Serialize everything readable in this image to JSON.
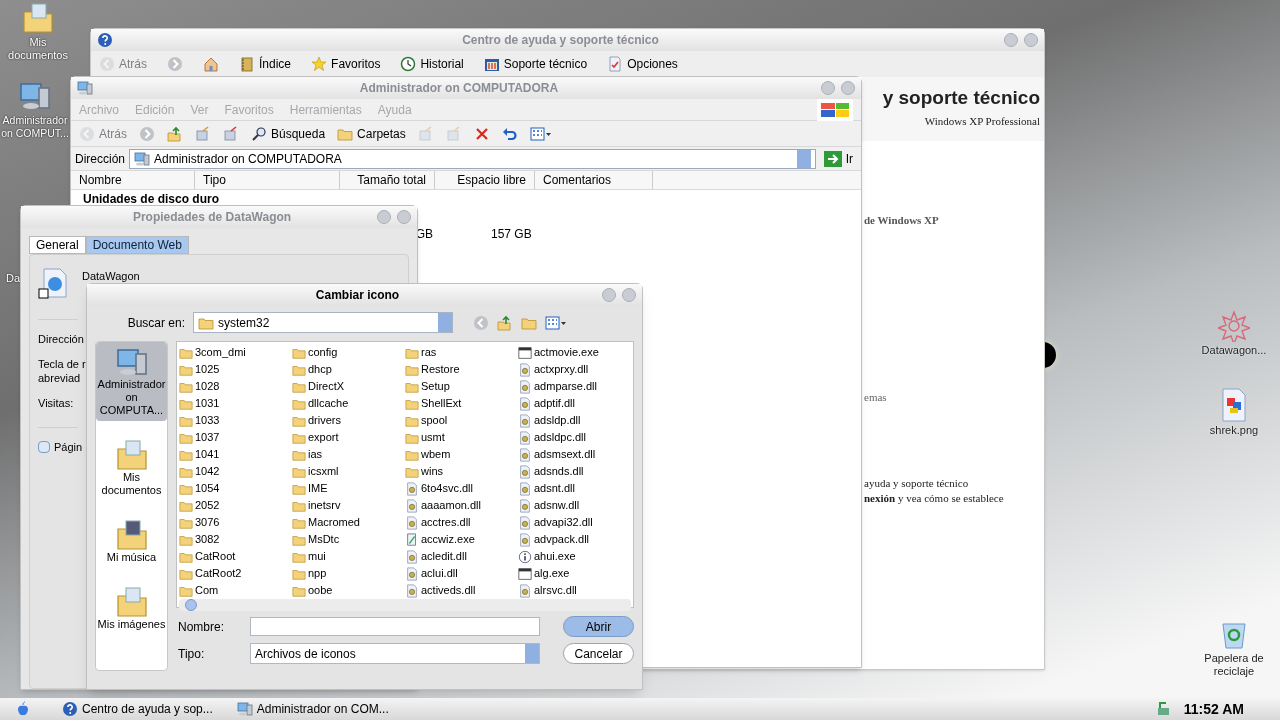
{
  "desktop_icons": [
    {
      "label": "Mis documentos",
      "kind": "documents"
    },
    {
      "label": "Administrador on COMPUT...",
      "kind": "computer"
    },
    {
      "label": "Da",
      "kind": "hidden"
    },
    {
      "label": "Datawagon...",
      "kind": "flower"
    },
    {
      "label": "shrek.png",
      "kind": "image"
    },
    {
      "label": "Papelera de reciclaje",
      "kind": "recycle"
    }
  ],
  "help_window": {
    "title": "Centro de ayuda y soporte técnico",
    "toolbar": [
      {
        "label": "Atrás",
        "kind": "back",
        "disabled": true
      },
      {
        "kind": "forward",
        "disabled": false
      },
      {
        "kind": "home",
        "disabled": false
      },
      {
        "label": "Índice",
        "kind": "index",
        "disabled": false
      },
      {
        "label": "Favoritos",
        "kind": "star",
        "disabled": false
      },
      {
        "label": "Historial",
        "kind": "history",
        "disabled": false
      },
      {
        "label": "Soporte técnico",
        "kind": "support",
        "disabled": false
      },
      {
        "label": "Opciones",
        "kind": "options",
        "disabled": false
      }
    ],
    "heading": "y soporte técnico",
    "subtitle": "Windows XP Professional",
    "fragments": [
      {
        "text": "de Windows XP",
        "kind": "bold"
      },
      {
        "text": "emas",
        "kind": "plain"
      },
      {
        "text": "ayuda y soporte técnico",
        "kind": "plain"
      },
      {
        "text": "**nexión** y vea cómo se establece",
        "kind": "plain"
      }
    ]
  },
  "explorer": {
    "title": "Administrador on COMPUTADORA",
    "menu": [
      "Archivo",
      "Edición",
      "Ver",
      "Favoritos",
      "Herramientas",
      "Ayuda"
    ],
    "toolbar": [
      {
        "label": "Atrás",
        "kind": "back",
        "disabled": true
      },
      {
        "kind": "forward",
        "disabled": false
      },
      {
        "kind": "up",
        "disabled": false
      },
      {
        "kind": "copy-to",
        "disabled": false
      },
      {
        "kind": "move-to",
        "disabled": false
      },
      {
        "label": "Búsqueda",
        "kind": "search",
        "disabled": false
      },
      {
        "label": "Carpetas",
        "kind": "folders",
        "disabled": false
      },
      {
        "kind": "move",
        "disabled": true
      },
      {
        "kind": "copy",
        "disabled": true
      },
      {
        "kind": "delete",
        "disabled": false
      },
      {
        "kind": "undo",
        "disabled": false
      },
      {
        "kind": "views",
        "disabled": false
      }
    ],
    "address_label": "Dirección",
    "address": "Administrador on COMPUTADORA",
    "go_label": "Ir",
    "columns": [
      "Nombre",
      "Tipo",
      "Tamaño total",
      "Espacio libre",
      "Comentarios"
    ],
    "group": "Unidades de disco duro",
    "row": {
      "total": "GB",
      "free": "157 GB"
    }
  },
  "properties": {
    "title": "Propiedades de DataWagon",
    "tabs": [
      {
        "label": "General",
        "selected": false
      },
      {
        "label": "Documento Web",
        "selected": true
      }
    ],
    "name": "DataWagon",
    "labels": [
      "Dirección",
      "Tecla de r",
      "abreviad",
      "Visitas:"
    ],
    "checkbox": {
      "label": "Págin",
      "checked": false
    }
  },
  "change_icon": {
    "title": "Cambiar icono",
    "look_in_label": "Buscar en:",
    "look_in": "system32",
    "places": [
      {
        "label": "Administrador on COMPUTA...",
        "kind": "computer",
        "selected": true
      },
      {
        "label": "Mis documentos",
        "kind": "documents",
        "selected": false
      },
      {
        "label": "Mi música",
        "kind": "music",
        "selected": false
      },
      {
        "label": "Mis imágenes",
        "kind": "pictures",
        "selected": false
      }
    ],
    "files": [
      {
        "name": "3com_dmi",
        "kind": "folder"
      },
      {
        "name": "1025",
        "kind": "folder"
      },
      {
        "name": "1028",
        "kind": "folder"
      },
      {
        "name": "1031",
        "kind": "folder"
      },
      {
        "name": "1033",
        "kind": "folder"
      },
      {
        "name": "1037",
        "kind": "folder"
      },
      {
        "name": "1041",
        "kind": "folder"
      },
      {
        "name": "1042",
        "kind": "folder"
      },
      {
        "name": "1054",
        "kind": "folder"
      },
      {
        "name": "2052",
        "kind": "folder"
      },
      {
        "name": "3076",
        "kind": "folder"
      },
      {
        "name": "3082",
        "kind": "folder"
      },
      {
        "name": "CatRoot",
        "kind": "folder"
      },
      {
        "name": "CatRoot2",
        "kind": "folder"
      },
      {
        "name": "Com",
        "kind": "folder"
      },
      {
        "name": "config",
        "kind": "folder"
      },
      {
        "name": "dhcp",
        "kind": "folder"
      },
      {
        "name": "DirectX",
        "kind": "folder"
      },
      {
        "name": "dllcache",
        "kind": "folder"
      },
      {
        "name": "drivers",
        "kind": "folder"
      },
      {
        "name": "export",
        "kind": "folder"
      },
      {
        "name": "ias",
        "kind": "folder"
      },
      {
        "name": "icsxml",
        "kind": "folder"
      },
      {
        "name": "IME",
        "kind": "folder"
      },
      {
        "name": "inetsrv",
        "kind": "folder"
      },
      {
        "name": "Macromed",
        "kind": "folder"
      },
      {
        "name": "MsDtc",
        "kind": "folder"
      },
      {
        "name": "mui",
        "kind": "folder"
      },
      {
        "name": "npp",
        "kind": "folder"
      },
      {
        "name": "oobe",
        "kind": "folder"
      },
      {
        "name": "ras",
        "kind": "folder"
      },
      {
        "name": "Restore",
        "kind": "folder"
      },
      {
        "name": "Setup",
        "kind": "folder"
      },
      {
        "name": "ShellExt",
        "kind": "folder"
      },
      {
        "name": "spool",
        "kind": "folder"
      },
      {
        "name": "usmt",
        "kind": "folder"
      },
      {
        "name": "wbem",
        "kind": "folder"
      },
      {
        "name": "wins",
        "kind": "folder"
      },
      {
        "name": "6to4svc.dll",
        "kind": "library"
      },
      {
        "name": "aaaamon.dll",
        "kind": "library"
      },
      {
        "name": "acctres.dll",
        "kind": "library"
      },
      {
        "name": "accwiz.exe",
        "kind": "wizard"
      },
      {
        "name": "acledit.dll",
        "kind": "library"
      },
      {
        "name": "aclui.dll",
        "kind": "library"
      },
      {
        "name": "activeds.dll",
        "kind": "library"
      },
      {
        "name": "actmovie.exe",
        "kind": "program"
      },
      {
        "name": "actxprxy.dll",
        "kind": "library"
      },
      {
        "name": "admparse.dll",
        "kind": "library"
      },
      {
        "name": "adptif.dll",
        "kind": "library"
      },
      {
        "name": "adsldp.dll",
        "kind": "library"
      },
      {
        "name": "adsldpc.dll",
        "kind": "library"
      },
      {
        "name": "adsmsext.dll",
        "kind": "library"
      },
      {
        "name": "adsnds.dll",
        "kind": "library"
      },
      {
        "name": "adsnt.dll",
        "kind": "library"
      },
      {
        "name": "adsnw.dll",
        "kind": "library"
      },
      {
        "name": "advapi32.dll",
        "kind": "library"
      },
      {
        "name": "advpack.dll",
        "kind": "library"
      },
      {
        "name": "ahui.exe",
        "kind": "info"
      },
      {
        "name": "alg.exe",
        "kind": "program"
      },
      {
        "name": "alrsvc.dll",
        "kind": "library"
      }
    ],
    "name_label": "Nombre:",
    "type_label": "Tipo:",
    "type_value": "Archivos de iconos",
    "open_label": "Abrir",
    "cancel_label": "Cancelar"
  },
  "taskbar": {
    "items": [
      {
        "label": "Centro de ayuda y sop...",
        "kind": "help"
      },
      {
        "label": "Administrador on COM...",
        "kind": "computer"
      }
    ],
    "clock": "11:52 AM"
  }
}
